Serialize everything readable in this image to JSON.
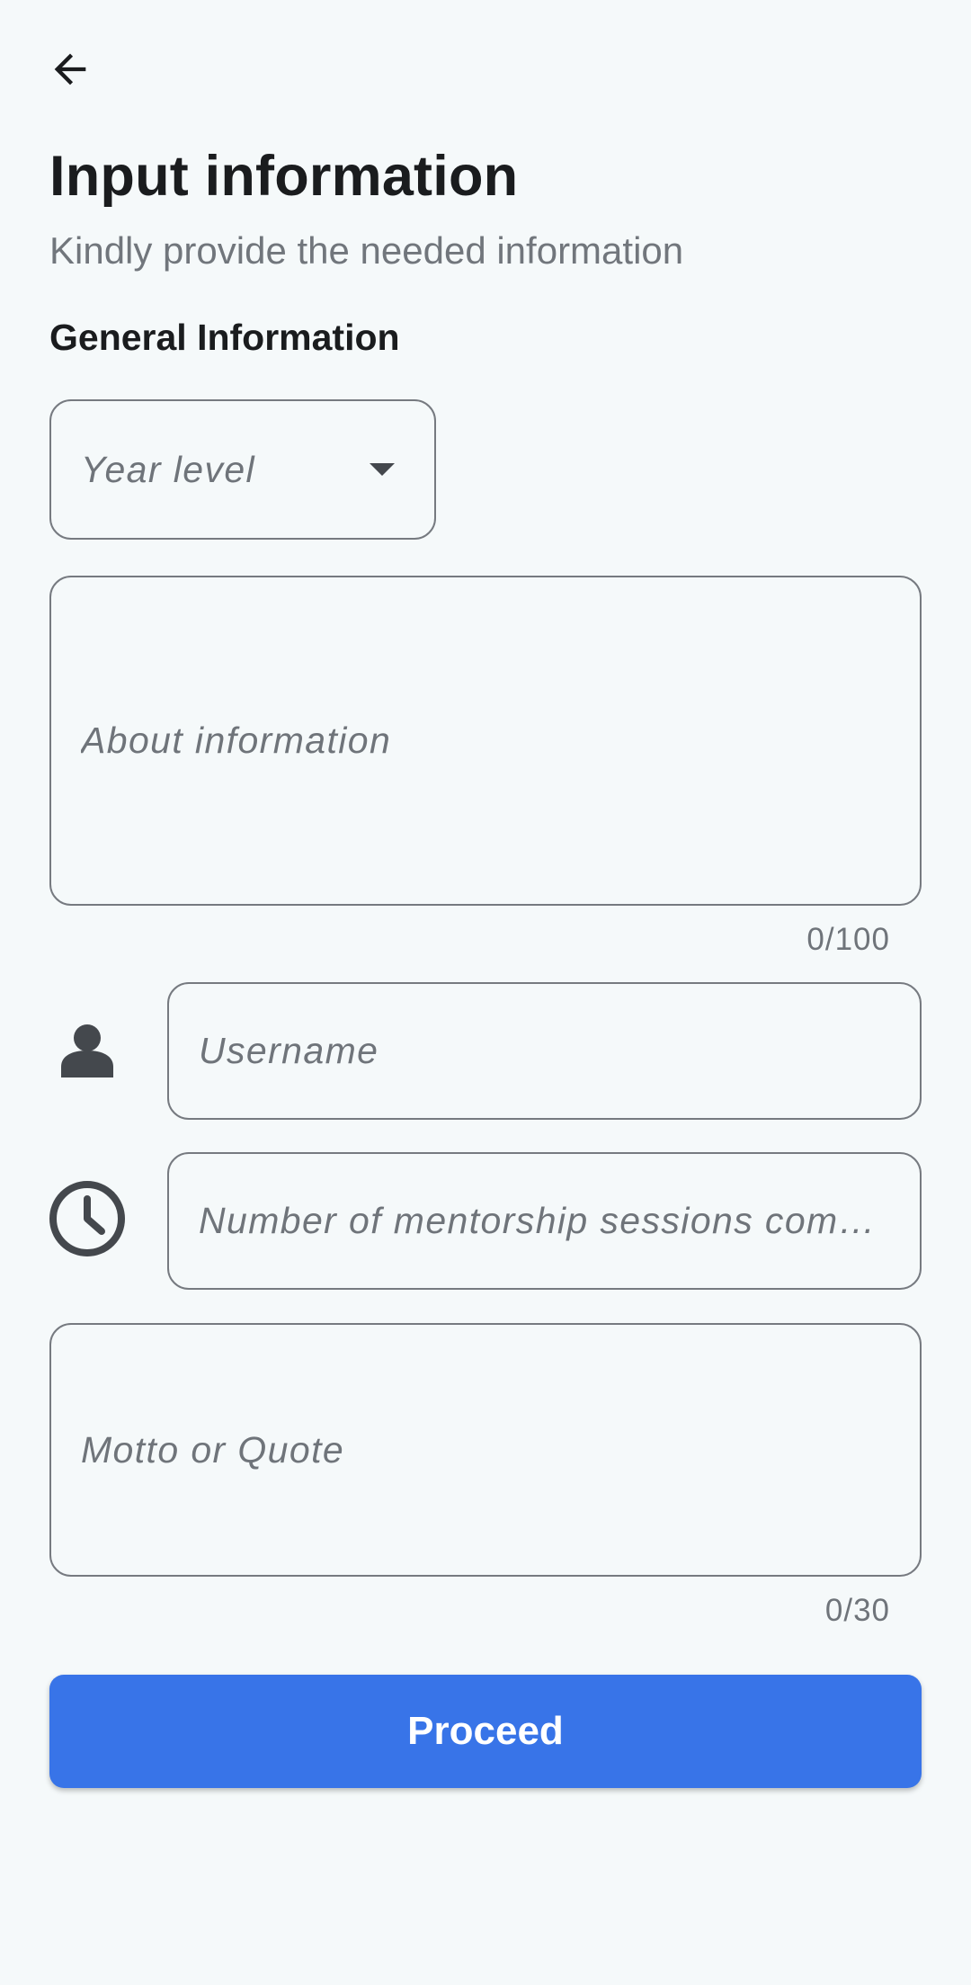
{
  "header": {
    "back_icon": "arrow-left-icon",
    "title": "Input information",
    "subtitle": "Kindly provide the needed information"
  },
  "form": {
    "section_label": "General Information",
    "year_level": {
      "placeholder": "Year level",
      "icon": "dropdown-arrow-icon"
    },
    "about": {
      "placeholder": "About information",
      "counter": "0/100"
    },
    "username": {
      "icon": "person-icon",
      "placeholder": "Username"
    },
    "sessions": {
      "icon": "clock-icon",
      "placeholder": "Number of mentorship sessions completed"
    },
    "motto": {
      "placeholder": "Motto or Quote",
      "counter": "0/30"
    }
  },
  "actions": {
    "proceed_label": "Proceed"
  },
  "colors": {
    "background": "#f5f9fa",
    "primary_button": "#3874e8",
    "border": "#767a80",
    "icon": "#44484d"
  }
}
